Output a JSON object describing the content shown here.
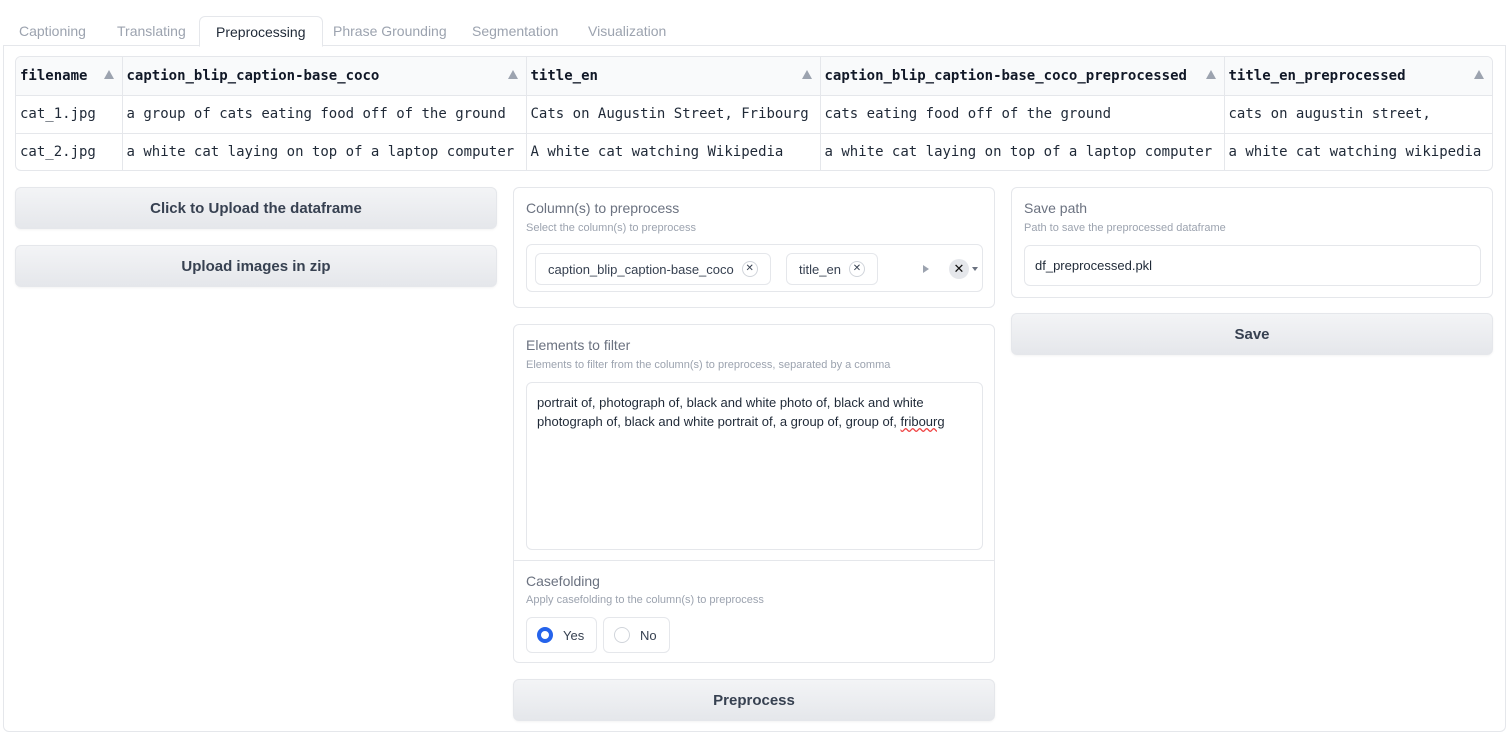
{
  "tabs": [
    "Captioning",
    "Translating",
    "Preprocessing",
    "Phrase Grounding",
    "Segmentation",
    "Visualization"
  ],
  "table": {
    "headers": [
      "filename",
      "caption_blip_caption-base_coco",
      "title_en",
      "caption_blip_caption-base_coco_preprocessed",
      "title_en_preprocessed"
    ],
    "rows": [
      [
        "cat_1.jpg",
        "a group of cats eating food off of the ground",
        "Cats on Augustin Street, Fribourg",
        "cats eating food off of the ground",
        "cats on augustin street,"
      ],
      [
        "cat_2.jpg",
        "a white cat laying on top of a laptop computer",
        "A white cat watching Wikipedia",
        "a white cat laying on top of a laptop computer",
        "a white cat watching wikipedia"
      ]
    ]
  },
  "buttons": {
    "upload_dataframe": "Click to Upload the dataframe",
    "upload_zip": "Upload images in zip",
    "preprocess": "Preprocess",
    "save": "Save"
  },
  "columns_panel": {
    "label": "Column(s) to preprocess",
    "info": "Select the column(s) to preprocess",
    "chips": [
      "caption_blip_caption-base_coco",
      "title_en"
    ]
  },
  "filter_panel": {
    "label": "Elements to filter",
    "info": "Elements to filter from the column(s) to preprocess, separated by a comma",
    "value_main": "portrait of, photograph of, black and white photo of, black and white photograph of, black and white portrait of, a group of, group of, ",
    "value_flagged": "fribourg"
  },
  "casefolding": {
    "label": "Casefolding",
    "info": "Apply casefolding to the column(s) to preprocess",
    "options": [
      "Yes",
      "No"
    ],
    "selected": "Yes"
  },
  "save_panel": {
    "label": "Save path",
    "info": "Path to save the preprocessed dataframe",
    "value": "df_preprocessed.pkl"
  },
  "colors": {
    "accent": "#2563eb",
    "border": "#e5e7eb"
  }
}
